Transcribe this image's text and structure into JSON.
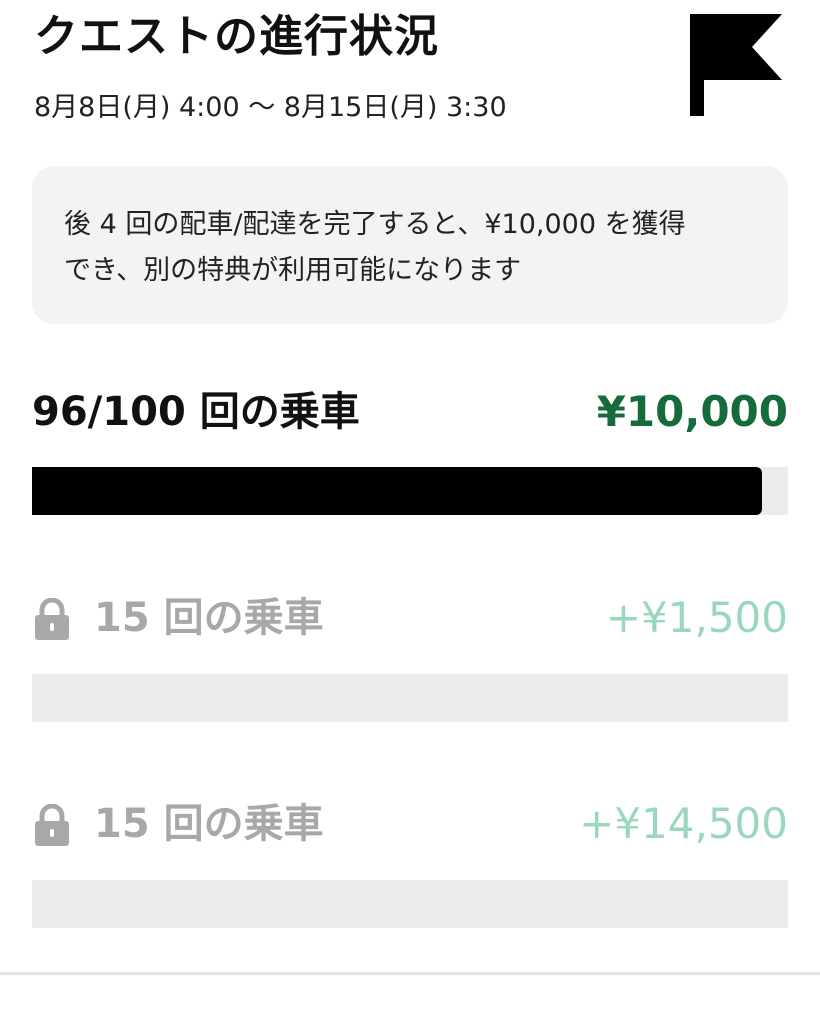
{
  "header": {
    "title": "クエストの進行状況",
    "date_range": "8月8日(月) 4:00 〜 8月15日(月) 3:30",
    "flag_icon": "flag-icon"
  },
  "info": {
    "line1": "後 4 回の配車/配達を完了すると、¥10,000 を獲得",
    "line2": "でき、別の特典が利用可能になります"
  },
  "main_tier": {
    "label": "96/100 回の乗車",
    "reward": "¥10,000",
    "progress": 0.965,
    "reward_color": "#156b3a"
  },
  "locked_tiers": [
    {
      "label": "15 回の乗車",
      "reward": "+¥1,500",
      "progress": 0,
      "icon": "lock-icon"
    },
    {
      "label": "15 回の乗車",
      "reward": "+¥14,500",
      "progress": 0,
      "icon": "lock-icon"
    }
  ],
  "colors": {
    "locked_reward": "#9ad8bb",
    "locked_text": "#a8a8a8",
    "track": "#ececec"
  }
}
